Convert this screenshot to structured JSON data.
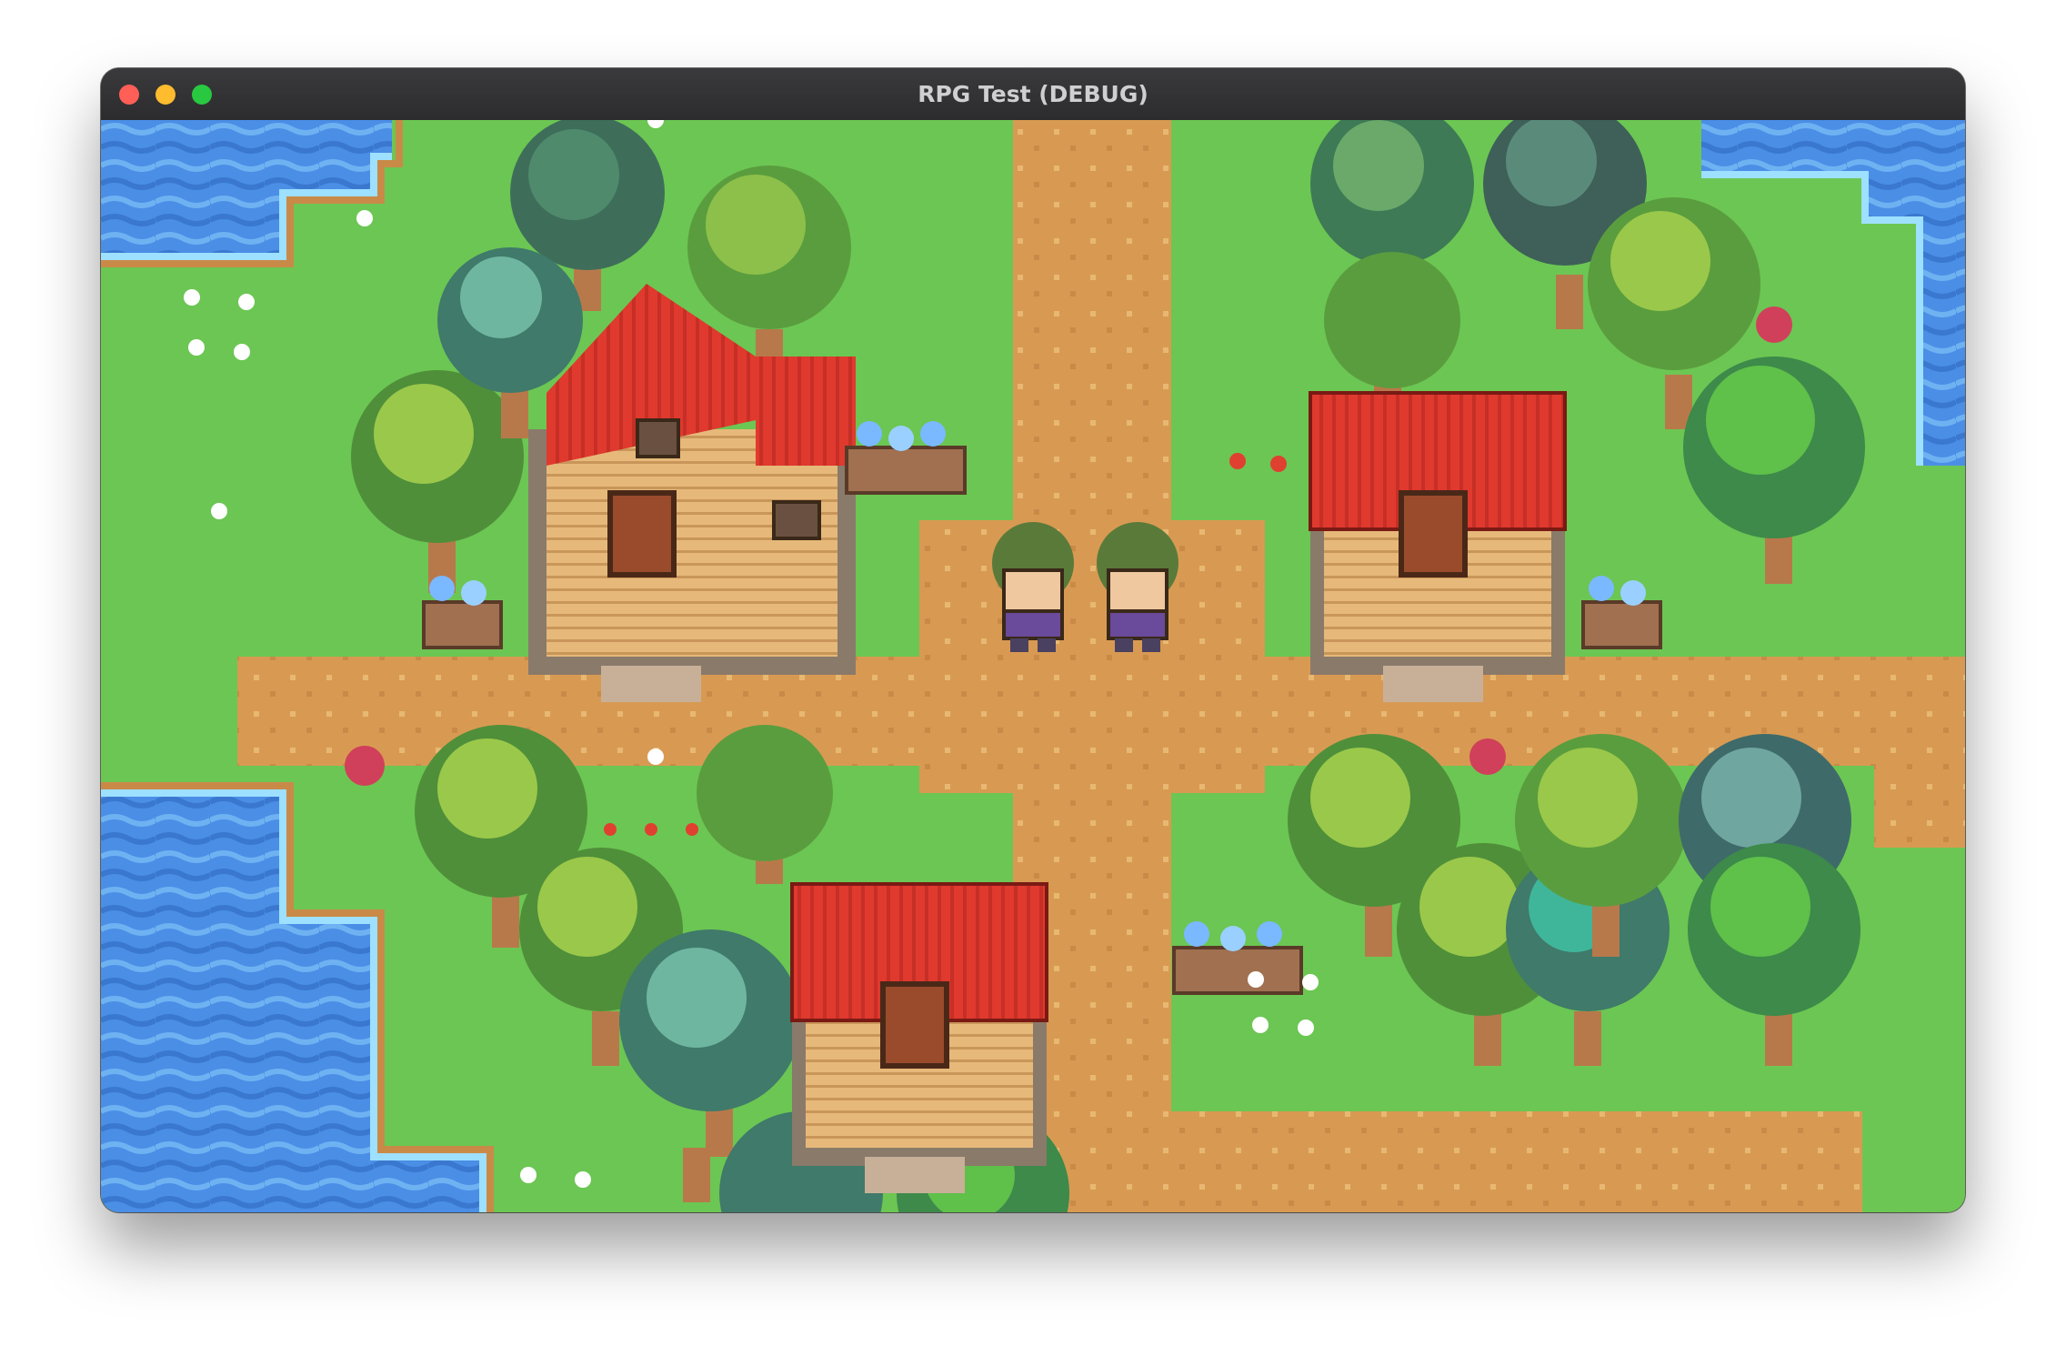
{
  "window": {
    "title": "RPG Test (DEBUG)"
  },
  "scene": {
    "colors": {
      "grass": "#6cc653",
      "path": "#d89a52",
      "water": "#4a8ee6",
      "roof": "#e0392e",
      "wall": "#e6b97a",
      "door": "#9a4b2c"
    },
    "houses": 3,
    "shops": 1,
    "characters": 2
  }
}
